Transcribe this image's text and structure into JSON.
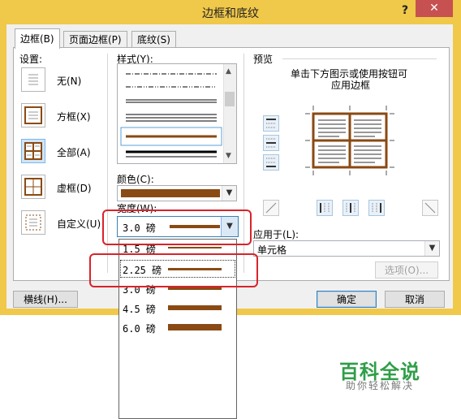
{
  "window": {
    "title": "边框和底纹",
    "help_label": "?",
    "close_label": "✕"
  },
  "tabs": [
    {
      "label": "边框(B)"
    },
    {
      "label": "页面边框(P)"
    },
    {
      "label": "底纹(S)"
    }
  ],
  "settings": {
    "heading": "设置:",
    "items": [
      {
        "label": "无(N)",
        "icon": "border-none-icon"
      },
      {
        "label": "方框(X)",
        "icon": "border-box-icon"
      },
      {
        "label": "全部(A)",
        "icon": "border-all-icon"
      },
      {
        "label": "虚框(D)",
        "icon": "border-grid-icon"
      },
      {
        "label": "自定义(U)",
        "icon": "border-custom-icon"
      }
    ]
  },
  "style": {
    "heading": "样式(Y):",
    "color_heading": "颜色(C):",
    "color_value": "#8a4a13",
    "width_heading": "宽度(W):",
    "width_value": "3.0 磅"
  },
  "width_options": [
    {
      "label": "1.5 磅",
      "pt": 1.5
    },
    {
      "label": "2.25 磅",
      "pt": 2.25
    },
    {
      "label": "3.0 磅",
      "pt": 3.0
    },
    {
      "label": "4.5 磅",
      "pt": 4.5
    },
    {
      "label": "6.0 磅",
      "pt": 6.0
    }
  ],
  "preview": {
    "heading": "预览",
    "hint_line1": "单击下方图示或使用按钮可",
    "hint_line2": "应用边框",
    "apply_to_heading": "应用于(L):",
    "apply_to_value": "单元格"
  },
  "buttons": {
    "options": "选项(O)...",
    "horizontal_line": "横线(H)...",
    "ok": "确定",
    "cancel": "取消"
  },
  "watermark": {
    "brand": "百科全说",
    "slogan": "助你轻松解决"
  },
  "colors": {
    "frame": "#f0c84a",
    "border_color": "#8a4a13",
    "highlight": "#d8232a",
    "watermark_green": "#2f9e47"
  }
}
